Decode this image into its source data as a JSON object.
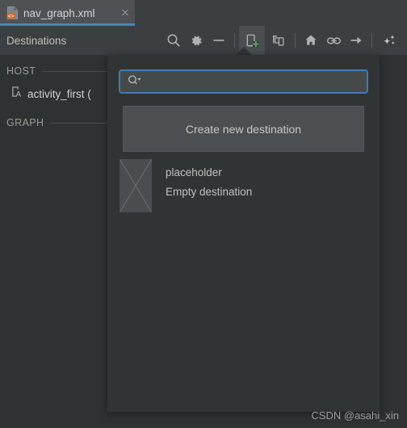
{
  "window": {
    "background_color": "#2f3233",
    "chrome_color": "#3c3f41"
  },
  "tab": {
    "label": "nav_graph.xml",
    "icon": "xml-file-icon",
    "close_icon": "close-icon",
    "active_underline_color": "#4a88a8",
    "badge_color": "#cf6a30"
  },
  "toolbar": {
    "title": "Destinations",
    "buttons": [
      {
        "name": "search-icon",
        "tooltip": "Search"
      },
      {
        "name": "gear-icon",
        "tooltip": "Settings"
      },
      {
        "name": "minus-icon",
        "tooltip": "Zoom out"
      },
      {
        "name": "new-destination-icon",
        "tooltip": "New Destination",
        "pressed": true,
        "badge_color": "#5aa25a"
      },
      {
        "name": "nested-graph-icon",
        "tooltip": "New Nested Graph"
      },
      {
        "name": "home-icon",
        "tooltip": "Assign start destination"
      },
      {
        "name": "link-icon",
        "tooltip": "Add deep link"
      },
      {
        "name": "arrow-right-icon",
        "tooltip": "Add action"
      },
      {
        "name": "sparkles-icon",
        "tooltip": "Auto arrange"
      }
    ]
  },
  "panel": {
    "sections": [
      {
        "label": "HOST"
      },
      {
        "label": "GRAPH"
      }
    ],
    "host_item": {
      "icon": "activity-icon",
      "label": "activity_first ("
    }
  },
  "popup": {
    "background_color": "#313435",
    "search": {
      "value": "",
      "placeholder": "",
      "icon": "search-dropdown-icon",
      "focus_border_color": "#3f7cb4"
    },
    "create_button": {
      "label": "Create new destination"
    },
    "destinations": [
      {
        "thumbnail": "placeholder-crossed-box-icon",
        "title": "placeholder",
        "subtitle": "Empty destination"
      }
    ]
  },
  "watermark": {
    "text": "CSDN @asahi_xin"
  }
}
